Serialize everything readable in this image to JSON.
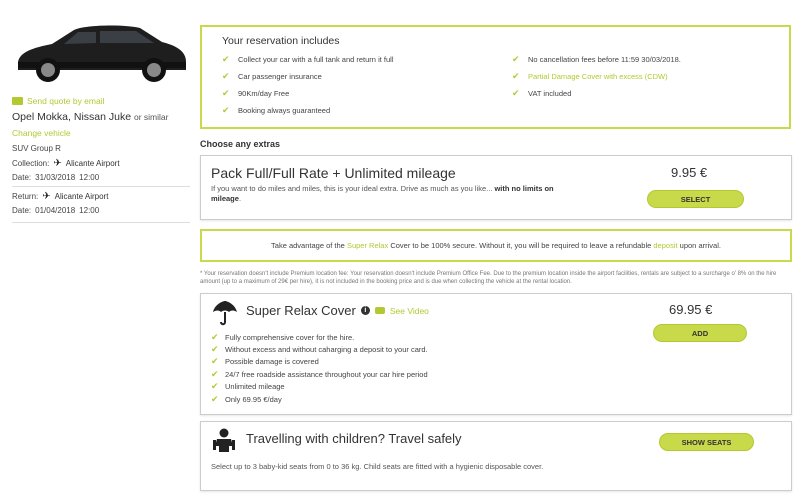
{
  "sidebar": {
    "send_quote": "Send quote by email",
    "car_name": "Opel Mokka, Nissan Juke",
    "or_similar": "or similar",
    "change_vehicle": "Change vehicle",
    "car_group": "SUV Group R",
    "collection_label": "Collection:",
    "collection_location": "Alicante Airport",
    "collection_date_label": "Date:",
    "collection_date": "31/03/2018",
    "collection_time": "12:00",
    "return_label": "Return:",
    "return_location": "Alicante Airport",
    "return_date_label": "Date:",
    "return_date": "01/04/2018",
    "return_time": "12:00"
  },
  "includes": {
    "title": "Your reservation includes",
    "items": [
      {
        "text": "Collect your car with a full tank and return it full",
        "link": false
      },
      {
        "text": "No cancellation fees before 11:59 30/03/2018.",
        "link": false
      },
      {
        "text": "Car passenger insurance",
        "link": false
      },
      {
        "text": "Partial Damage Cover with excess (CDW)",
        "link": true
      },
      {
        "text": "90Km/day Free",
        "link": false
      },
      {
        "text": "VAT included",
        "link": false
      },
      {
        "text": "Booking always guaranteed",
        "link": false
      }
    ]
  },
  "extras_title": "Choose any extras",
  "pack": {
    "title": "Pack Full/Full Rate + Unlimited mileage",
    "desc": "If you want to do miles and miles, this is your ideal extra. Drive as much as you like...",
    "desc_bold": "with no limits on mileage",
    "desc_end": ".",
    "price": "9.95 €",
    "button": "SELECT"
  },
  "relax_note": {
    "pre": "Take advantage of the",
    "link1": "Super Relax",
    "mid": "Cover to be 100% secure. Without it, you will be required to leave a refundable",
    "link2": "deposit",
    "post": "upon arrival."
  },
  "footnote": "* Your reservation doesn't include Premium location fee: Your reservation doesn't include Premium Office Fee. Due to the premium location inside the airport facilities, rentals are subject to a surcharge o' 8% on the hire amount (up to a maximum of 29€ per hire), it is not included in the booking price and is due when collecting the vehicle at the rental location.",
  "relax": {
    "title": "Super Relax Cover",
    "see_video": "See Video",
    "price": "69.95 €",
    "button": "ADD",
    "items": [
      "Fully comprehensive cover for the hire.",
      "Without excess and without caharging a deposit to your card.",
      "Possible damage is covered",
      "24/7 free roadside assistance throughout your car hire period",
      "Unlimited mileage",
      "Only 69.95 €/day"
    ]
  },
  "kids": {
    "title": "Travelling with children? Travel safely",
    "button": "SHOW SEATS",
    "desc": "Select up to 3 baby-kid seats from 0 to 36 kg. Child seats are fitted with a hygienic disposable cover."
  },
  "colors": {
    "accent": "#c8d94a",
    "accent_text": "#b4c832"
  }
}
